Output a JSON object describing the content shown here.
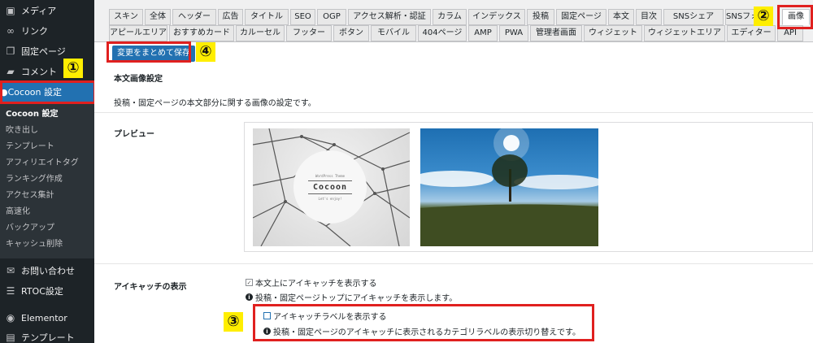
{
  "sidebar": {
    "items": [
      {
        "label": "メディア",
        "icon": "media-icon"
      },
      {
        "label": "リンク",
        "icon": "link-icon"
      },
      {
        "label": "固定ページ",
        "icon": "page-icon"
      },
      {
        "label": "コメント",
        "icon": "comment-icon"
      },
      {
        "label": "Cocoon 設定",
        "icon": "cocoon-icon"
      },
      {
        "label": "お問い合わせ",
        "icon": "mail-icon"
      },
      {
        "label": "RTOC設定",
        "icon": "list-icon"
      },
      {
        "label": "Elementor",
        "icon": "elementor-icon"
      },
      {
        "label": "テンプレート",
        "icon": "folder-icon"
      }
    ],
    "submenu": [
      "Cocoon 設定",
      "吹き出し",
      "テンプレート",
      "アフィリエイトタグ",
      "ランキング作成",
      "アクセス集計",
      "高速化",
      "バックアップ",
      "キャッシュ削除"
    ]
  },
  "tabs_row1": [
    "スキン",
    "全体",
    "ヘッダー",
    "広告",
    "タイトル",
    "SEO",
    "OGP",
    "アクセス解析・認証",
    "カラム",
    "インデックス",
    "投稿",
    "固定ページ",
    "本文",
    "目次",
    "SNSシェア",
    "SNSフォ",
    "画像"
  ],
  "tabs_row2": [
    "アピールエリア",
    "おすすめカード",
    "カルーセル",
    "フッター",
    "ボタン",
    "モバイル",
    "404ページ",
    "AMP",
    "PWA",
    "管理者画面",
    "ウィジェット",
    "ウィジェットエリア",
    "エディター",
    "API"
  ],
  "badges": [
    "①",
    "②",
    "③",
    "④"
  ],
  "main": {
    "save_label": "変更をまとめて保存",
    "section_title": "本文画像設定",
    "section_desc": "投稿・固定ページの本文部分に関する画像の設定です。",
    "preview_label": "プレビュー",
    "preview_logo_sub": "WordPress Theme",
    "preview_logo_main": "Cocoon",
    "preview_logo_tag": "Let's enjoy!",
    "eyecatch_label": "アイキャッチの表示",
    "opt1_label": "本文上にアイキャッチを表示する",
    "opt1_checked": true,
    "opt1_info": "投稿・固定ページトップにアイキャッチを表示します。",
    "opt2_label": "アイキャッチラベルを表示する",
    "opt2_checked": false,
    "opt2_info": "投稿・固定ページのアイキャッチに表示されるカテゴリラベルの表示切り替えです。"
  },
  "colors": {
    "accent": "#2271b1",
    "highlight": "#e0201f",
    "badge": "#ffee00",
    "sidebar": "#1d2327"
  }
}
